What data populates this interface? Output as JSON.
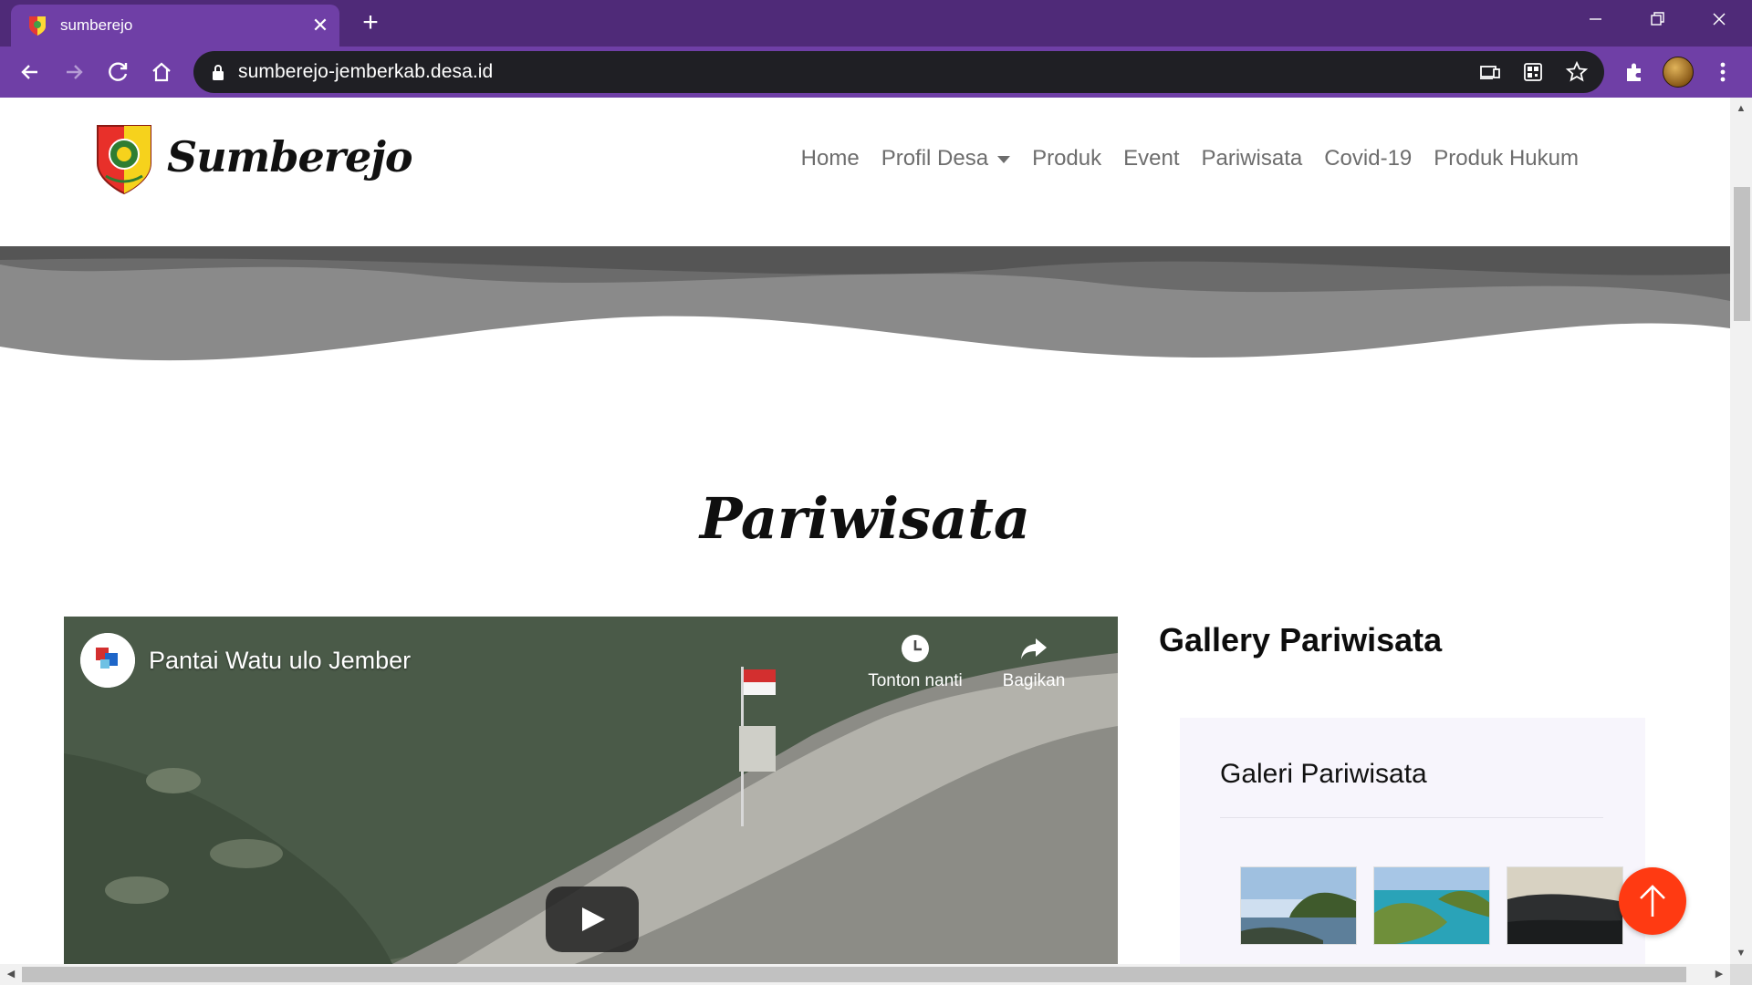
{
  "browser": {
    "tab": {
      "title": "sumberejo",
      "close_glyph": "✕"
    },
    "new_tab_glyph": "+",
    "address_bar": {
      "url": "sumberejo-jemberkab.desa.id"
    },
    "icons": [
      "back-icon",
      "forward-icon",
      "reload-icon",
      "home-icon",
      "lock-icon",
      "cast-icon",
      "qr-code-icon",
      "star-icon",
      "extensions-icon",
      "menu-icon"
    ],
    "colors": {
      "tabstrip": "#4f2a78",
      "toolbar": "#6f3fa6",
      "omnibox": "#1f1f24"
    }
  },
  "site": {
    "brand": "Sumberejo",
    "nav": {
      "items": [
        "Home",
        "Profil Desa",
        "Produk",
        "Event",
        "Pariwisata",
        "Covid-19",
        "Produk Hukum"
      ]
    },
    "section_title": "Pariwisata",
    "video": {
      "title": "Pantai Watu ulo Jember",
      "watch_later": "Tonton nanti",
      "share": "Bagikan"
    },
    "gallery": {
      "heading": "Gallery Pariwisata",
      "card_title": "Galeri Pariwisata",
      "thumbnails": 3
    },
    "colors": {
      "accent": "#ff3a12",
      "nav_text": "#6d6d6d"
    }
  }
}
